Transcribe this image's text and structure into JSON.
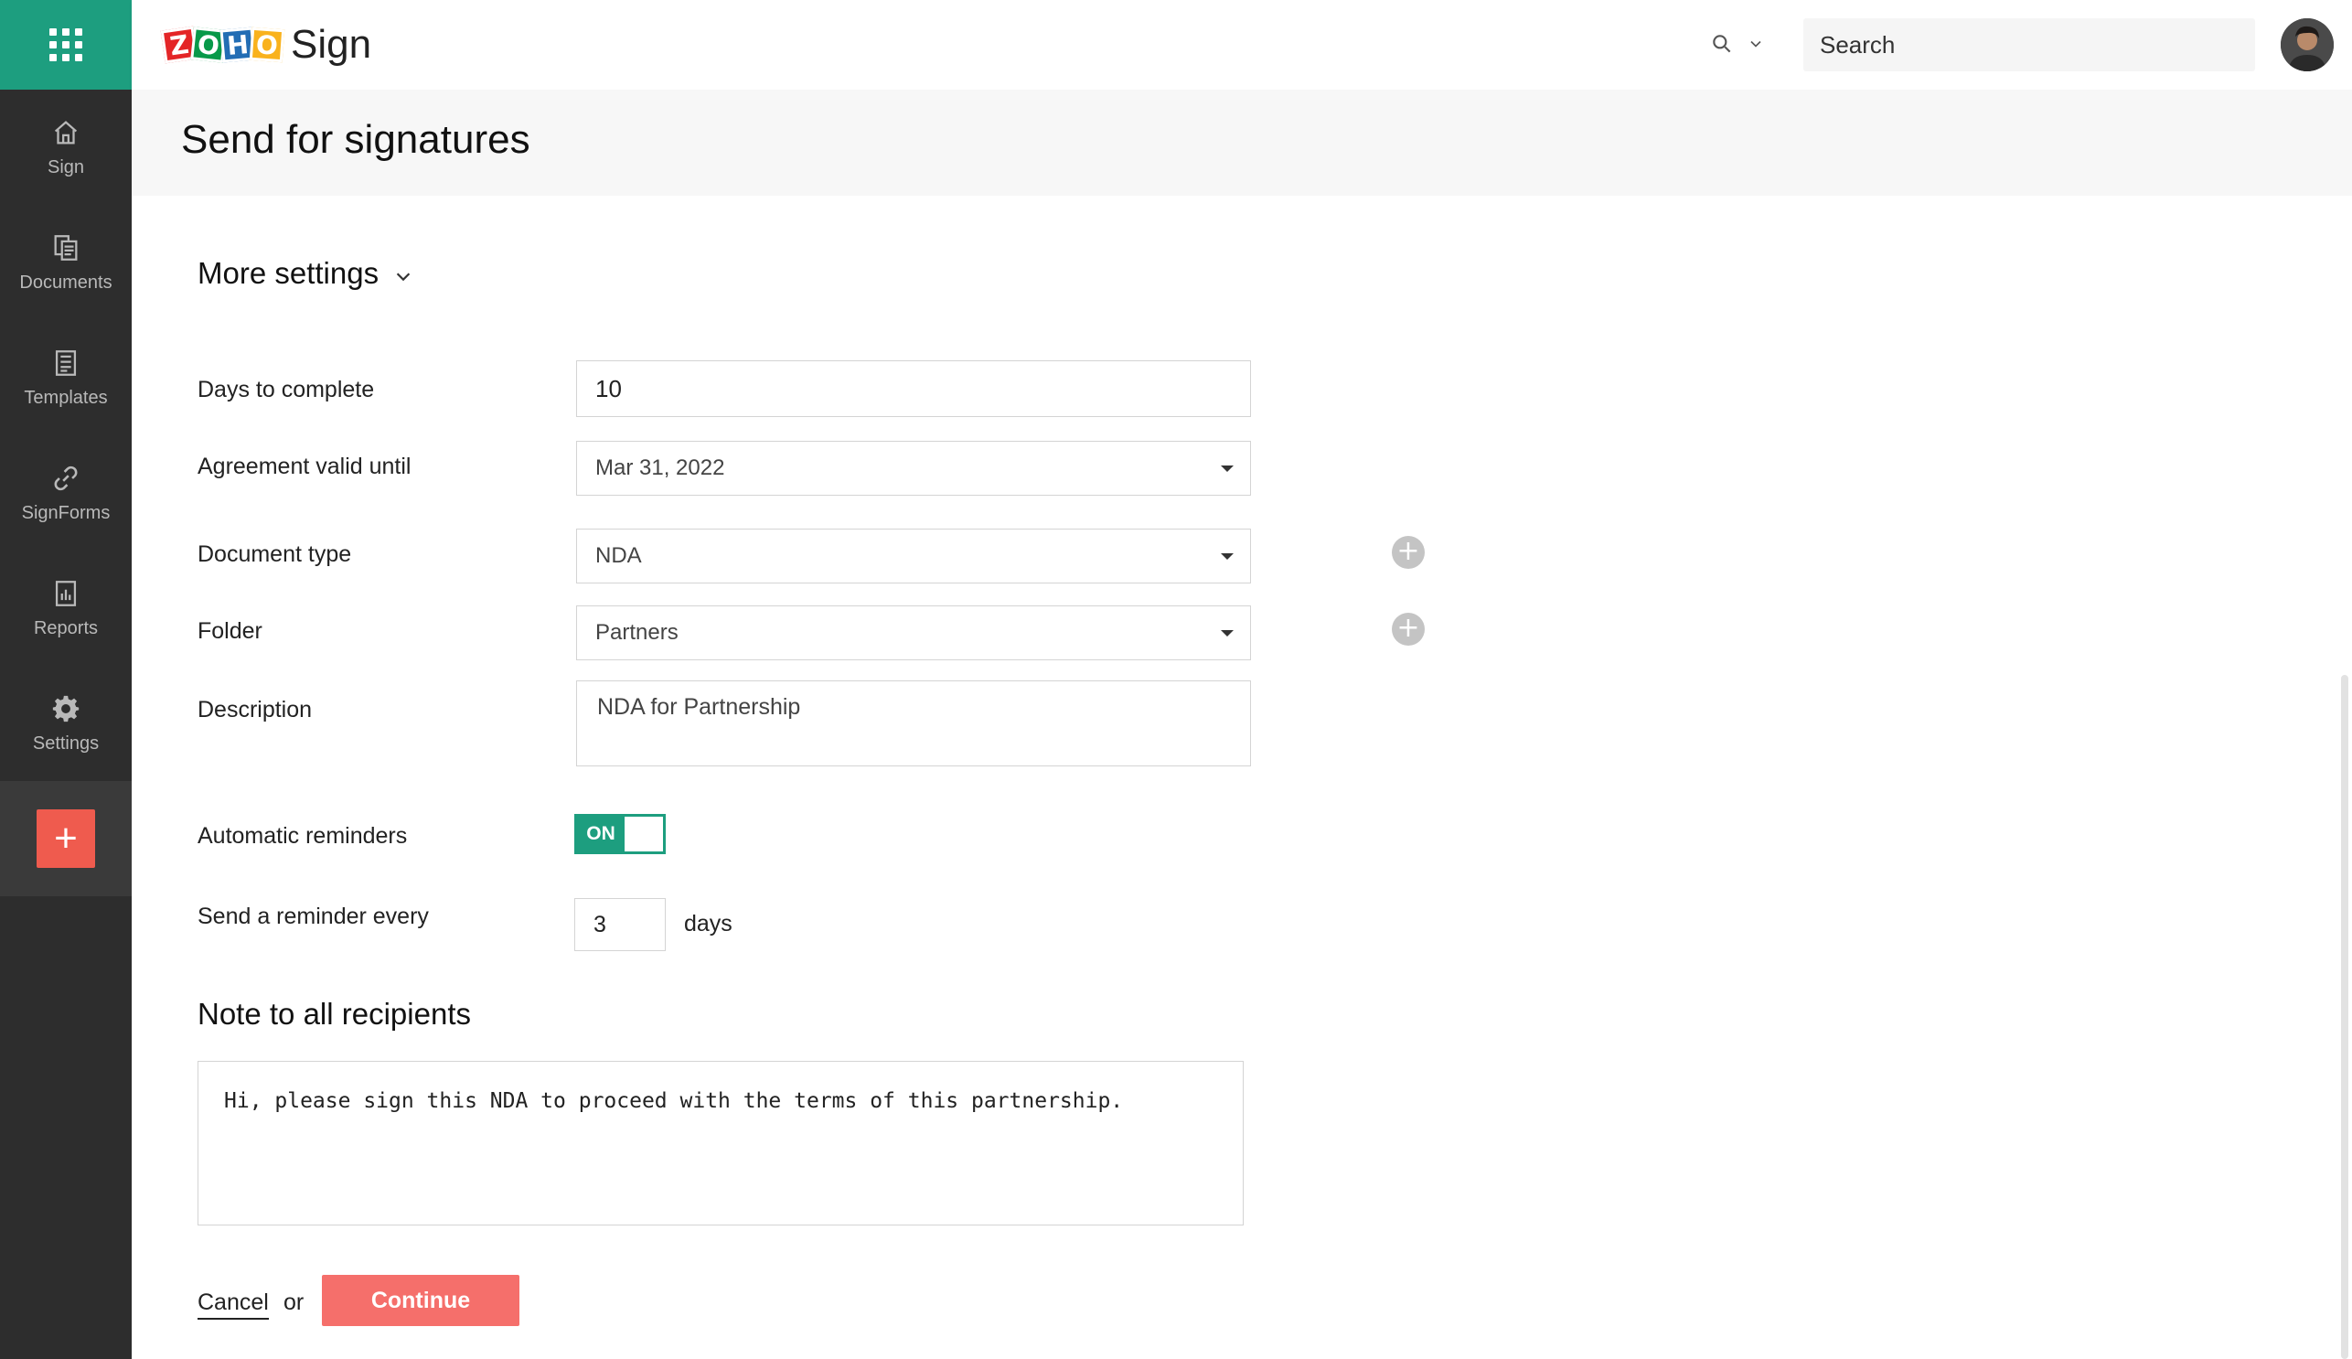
{
  "app": {
    "name": "Sign",
    "logo_letters": [
      "Z",
      "O",
      "H",
      "O"
    ]
  },
  "colors": {
    "accent_green": "#1d9e7f",
    "accent_red": "#ef5b4e",
    "continue_button": "#f56f6b",
    "sidebar_bg": "#2d2d2d"
  },
  "sidebar": {
    "items": [
      {
        "label": "Sign",
        "icon": "home-icon"
      },
      {
        "label": "Documents",
        "icon": "documents-icon"
      },
      {
        "label": "Templates",
        "icon": "templates-icon"
      },
      {
        "label": "SignForms",
        "icon": "link-icon"
      },
      {
        "label": "Reports",
        "icon": "reports-icon"
      },
      {
        "label": "Settings",
        "icon": "gear-icon"
      }
    ],
    "add_label": "+"
  },
  "topbar": {
    "search_placeholder": "Search"
  },
  "page": {
    "title": "Send for signatures"
  },
  "settings": {
    "section_title": "More settings",
    "days_to_complete": {
      "label": "Days to complete",
      "value": "10"
    },
    "agreement_valid_until": {
      "label": "Agreement valid until",
      "value": "Mar 31, 2022"
    },
    "document_type": {
      "label": "Document type",
      "value": "NDA"
    },
    "folder": {
      "label": "Folder",
      "value": "Partners"
    },
    "description": {
      "label": "Description",
      "value": "NDA for Partnership"
    },
    "automatic_reminders": {
      "label": "Automatic reminders",
      "state": "ON"
    },
    "reminder_every": {
      "label": "Send a reminder every",
      "value": "3",
      "unit": "days"
    }
  },
  "note": {
    "title": "Note to all recipients",
    "value": "Hi, please sign this NDA to proceed with the terms of this partnership."
  },
  "actions": {
    "cancel": "Cancel",
    "or": "or",
    "continue": "Continue"
  }
}
